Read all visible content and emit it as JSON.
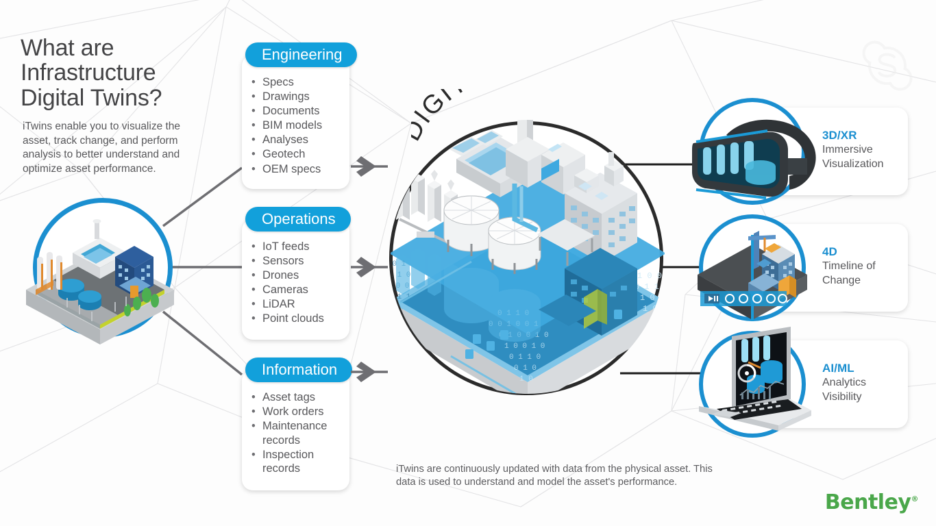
{
  "page": {
    "title": "What are Infrastructure Digital Twins?",
    "headline_line1": "What are",
    "headline_line2": "Infrastructure",
    "headline_line3": "Digital Twins?",
    "subcopy": "iTwins enable you to visualize the asset, track change, and perform analysis to better understand and optimize asset performance.",
    "center_label": "DIGITAL TWIN",
    "bottom_caption": "iTwins are continuously updated with data from the physical asset. This data is used to understand and model the asset's performance.",
    "brand": "Bentley",
    "brand_mark": "®",
    "watermark": "S"
  },
  "colors": {
    "accent_blue": "#12a0db",
    "ring_blue": "#1b8fd0",
    "title_blue": "#1b8fd0",
    "text_gray": "#58585b",
    "heading_gray": "#444446",
    "connector_gray": "#6e6e72",
    "connector_dark": "#222222",
    "brand_green": "#4aa74a"
  },
  "source_cards": [
    {
      "id": "engineering",
      "label": "Engineering",
      "items": [
        "Specs",
        "Drawings",
        "Documents",
        "BIM models",
        "Analyses",
        "Geotech",
        "OEM specs"
      ]
    },
    {
      "id": "operations",
      "label": "Operations",
      "items": [
        "IoT feeds",
        "Sensors",
        "Drones",
        "Cameras",
        "LiDAR",
        "Point clouds"
      ]
    },
    {
      "id": "information",
      "label": "Information",
      "items": [
        "Asset tags",
        "Work orders",
        "Maintenance records",
        "Inspection records"
      ]
    }
  ],
  "output_cards": [
    {
      "id": "3dxr",
      "title": "3D/XR",
      "subtitle": "Immersive Visualization",
      "icon": "vr-headset-icon"
    },
    {
      "id": "4d",
      "title": "4D",
      "subtitle": "Timeline of Change",
      "icon": "timeline-icon"
    },
    {
      "id": "aiml",
      "title": "AI/ML",
      "subtitle": "Analytics Visibility",
      "icon": "laptop-analytics-icon"
    }
  ],
  "timeline_control": {
    "play_glyph": "▶",
    "pause_glyph": "‖",
    "marker_count": 5
  },
  "asset_medallion": {
    "label": "physical-asset-isometric"
  }
}
